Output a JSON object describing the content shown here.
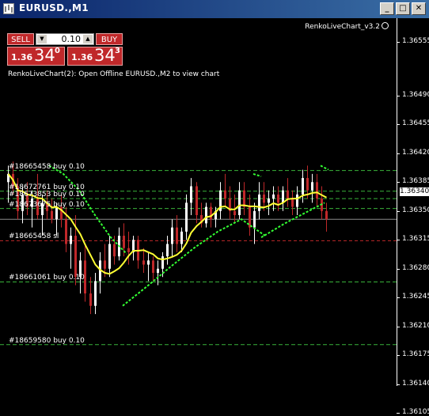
{
  "window": {
    "title": "EURUSD.,M1",
    "controls": {
      "minimize": "_",
      "maximize": "□",
      "close": "✕"
    }
  },
  "trade_panel": {
    "sell_label": "SELL",
    "buy_label": "BUY",
    "volume": "0.10",
    "sell_price_prefix": "1.36",
    "sell_price_big": "34",
    "sell_price_sup": "0",
    "buy_price_prefix": "1.36",
    "buy_price_big": "34",
    "buy_price_sup": "3"
  },
  "indicator_label": "RenkoLiveChart_v3.2",
  "chart_message": "RenkoLiveChart(2): Open Offline EURUSD.,M2 to view chart",
  "order_lines": [
    {
      "label": "#18665458 buy 0.10",
      "price": 1.36399
    },
    {
      "label": "#18672761 buy 0.10",
      "price": 1.36374
    },
    {
      "label": "#18673853 buy 0.10",
      "price": 1.36365
    },
    {
      "label": "#18673675 buy 0.10",
      "price": 1.36353
    },
    {
      "label": "#18665458 sl",
      "price": 1.36314
    },
    {
      "label": "#18661061 buy 0.10",
      "price": 1.36264
    },
    {
      "label": "#18659580 buy 0.10",
      "price": 1.36188
    }
  ],
  "price_axis": {
    "ticks": [
      "1.36555",
      "1.36490",
      "1.36455",
      "1.36420",
      "1.36385",
      "1.36350",
      "1.36315",
      "1.36280",
      "1.36245",
      "1.36210",
      "1.36175",
      "1.36140",
      "1.36105"
    ],
    "current_price": "1.36340"
  },
  "colors": {
    "background": "#000000",
    "bull_candle": "#ffffff",
    "bear_candle": "#c0282a",
    "order_line": "#39b33a",
    "stop_line": "#c0282a",
    "moving_average": "#ffff33",
    "trend_dots": "#33ff33"
  },
  "chart_data": {
    "type": "candlestick",
    "symbol": "EURUSD.",
    "timeframe": "M1",
    "ylim": [
      1.36105,
      1.36575
    ],
    "candles": [
      {
        "o": 1.36385,
        "h": 1.36405,
        "l": 1.3636,
        "c": 1.36395
      },
      {
        "o": 1.36395,
        "h": 1.3641,
        "l": 1.3637,
        "c": 1.3638
      },
      {
        "o": 1.3638,
        "h": 1.3639,
        "l": 1.3634,
        "c": 1.3635
      },
      {
        "o": 1.3635,
        "h": 1.3638,
        "l": 1.36335,
        "c": 1.3637
      },
      {
        "o": 1.3637,
        "h": 1.36385,
        "l": 1.36345,
        "c": 1.36355
      },
      {
        "o": 1.36355,
        "h": 1.36375,
        "l": 1.3633,
        "c": 1.36365
      },
      {
        "o": 1.36365,
        "h": 1.36395,
        "l": 1.3634,
        "c": 1.36345
      },
      {
        "o": 1.36345,
        "h": 1.3637,
        "l": 1.3632,
        "c": 1.3636
      },
      {
        "o": 1.3636,
        "h": 1.36375,
        "l": 1.3634,
        "c": 1.3635
      },
      {
        "o": 1.3635,
        "h": 1.36365,
        "l": 1.36335,
        "c": 1.3634
      },
      {
        "o": 1.3634,
        "h": 1.3636,
        "l": 1.3632,
        "c": 1.36355
      },
      {
        "o": 1.36355,
        "h": 1.3637,
        "l": 1.3633,
        "c": 1.3634
      },
      {
        "o": 1.3634,
        "h": 1.36355,
        "l": 1.363,
        "c": 1.3631
      },
      {
        "o": 1.3631,
        "h": 1.3633,
        "l": 1.3628,
        "c": 1.3632
      },
      {
        "o": 1.3632,
        "h": 1.36345,
        "l": 1.3626,
        "c": 1.3627
      },
      {
        "o": 1.3627,
        "h": 1.363,
        "l": 1.3625,
        "c": 1.3629
      },
      {
        "o": 1.3629,
        "h": 1.3631,
        "l": 1.3624,
        "c": 1.3625
      },
      {
        "o": 1.3625,
        "h": 1.3627,
        "l": 1.36225,
        "c": 1.36235
      },
      {
        "o": 1.36235,
        "h": 1.36275,
        "l": 1.36225,
        "c": 1.36265
      },
      {
        "o": 1.36265,
        "h": 1.363,
        "l": 1.3625,
        "c": 1.3629
      },
      {
        "o": 1.3629,
        "h": 1.3631,
        "l": 1.3627,
        "c": 1.3628
      },
      {
        "o": 1.3628,
        "h": 1.3632,
        "l": 1.3627,
        "c": 1.3631
      },
      {
        "o": 1.3631,
        "h": 1.3632,
        "l": 1.36285,
        "c": 1.36295
      },
      {
        "o": 1.36295,
        "h": 1.3633,
        "l": 1.3629,
        "c": 1.3632
      },
      {
        "o": 1.3632,
        "h": 1.36335,
        "l": 1.36295,
        "c": 1.36305
      },
      {
        "o": 1.36305,
        "h": 1.36325,
        "l": 1.36285,
        "c": 1.363
      },
      {
        "o": 1.363,
        "h": 1.3632,
        "l": 1.3629,
        "c": 1.36315
      },
      {
        "o": 1.36315,
        "h": 1.3632,
        "l": 1.3628,
        "c": 1.3629
      },
      {
        "o": 1.3629,
        "h": 1.36305,
        "l": 1.36275,
        "c": 1.36285
      },
      {
        "o": 1.36285,
        "h": 1.363,
        "l": 1.36265,
        "c": 1.3629
      },
      {
        "o": 1.3629,
        "h": 1.36295,
        "l": 1.36265,
        "c": 1.36275
      },
      {
        "o": 1.36275,
        "h": 1.3629,
        "l": 1.3626,
        "c": 1.3628
      },
      {
        "o": 1.3628,
        "h": 1.363,
        "l": 1.3627,
        "c": 1.36295
      },
      {
        "o": 1.36295,
        "h": 1.3632,
        "l": 1.36285,
        "c": 1.3631
      },
      {
        "o": 1.3631,
        "h": 1.3634,
        "l": 1.36295,
        "c": 1.3633
      },
      {
        "o": 1.3633,
        "h": 1.36345,
        "l": 1.363,
        "c": 1.3631
      },
      {
        "o": 1.3631,
        "h": 1.3633,
        "l": 1.363,
        "c": 1.36325
      },
      {
        "o": 1.36325,
        "h": 1.3637,
        "l": 1.36315,
        "c": 1.3636
      },
      {
        "o": 1.3636,
        "h": 1.3639,
        "l": 1.36345,
        "c": 1.3638
      },
      {
        "o": 1.3638,
        "h": 1.36385,
        "l": 1.36335,
        "c": 1.36345
      },
      {
        "o": 1.36345,
        "h": 1.3636,
        "l": 1.3633,
        "c": 1.36335
      },
      {
        "o": 1.36335,
        "h": 1.3636,
        "l": 1.3633,
        "c": 1.36355
      },
      {
        "o": 1.36355,
        "h": 1.3636,
        "l": 1.3633,
        "c": 1.3634
      },
      {
        "o": 1.3634,
        "h": 1.36355,
        "l": 1.3633,
        "c": 1.3635
      },
      {
        "o": 1.3635,
        "h": 1.36385,
        "l": 1.3634,
        "c": 1.36375
      },
      {
        "o": 1.36375,
        "h": 1.36395,
        "l": 1.36355,
        "c": 1.36365
      },
      {
        "o": 1.36365,
        "h": 1.3638,
        "l": 1.3634,
        "c": 1.3635
      },
      {
        "o": 1.3635,
        "h": 1.3637,
        "l": 1.36335,
        "c": 1.36345
      },
      {
        "o": 1.36345,
        "h": 1.36385,
        "l": 1.3634,
        "c": 1.36375
      },
      {
        "o": 1.36375,
        "h": 1.36385,
        "l": 1.36345,
        "c": 1.36355
      },
      {
        "o": 1.36355,
        "h": 1.3637,
        "l": 1.3632,
        "c": 1.3633
      },
      {
        "o": 1.3633,
        "h": 1.3636,
        "l": 1.3631,
        "c": 1.3635
      },
      {
        "o": 1.3635,
        "h": 1.36385,
        "l": 1.3634,
        "c": 1.3637
      },
      {
        "o": 1.3637,
        "h": 1.36385,
        "l": 1.3635,
        "c": 1.3636
      },
      {
        "o": 1.3636,
        "h": 1.36375,
        "l": 1.36345,
        "c": 1.36365
      },
      {
        "o": 1.36365,
        "h": 1.3638,
        "l": 1.3635,
        "c": 1.3637
      },
      {
        "o": 1.3637,
        "h": 1.3638,
        "l": 1.3635,
        "c": 1.3636
      },
      {
        "o": 1.3636,
        "h": 1.3638,
        "l": 1.3635,
        "c": 1.36375
      },
      {
        "o": 1.36375,
        "h": 1.3639,
        "l": 1.36355,
        "c": 1.36365
      },
      {
        "o": 1.36365,
        "h": 1.36375,
        "l": 1.36345,
        "c": 1.36355
      },
      {
        "o": 1.36355,
        "h": 1.3638,
        "l": 1.36345,
        "c": 1.3637
      },
      {
        "o": 1.3637,
        "h": 1.364,
        "l": 1.3636,
        "c": 1.3639
      },
      {
        "o": 1.3639,
        "h": 1.36405,
        "l": 1.36365,
        "c": 1.36375
      },
      {
        "o": 1.36375,
        "h": 1.36395,
        "l": 1.3636,
        "c": 1.36385
      },
      {
        "o": 1.36385,
        "h": 1.36395,
        "l": 1.36355,
        "c": 1.36365
      },
      {
        "o": 1.36365,
        "h": 1.3638,
        "l": 1.3634,
        "c": 1.3635
      },
      {
        "o": 1.3635,
        "h": 1.3636,
        "l": 1.36325,
        "c": 1.3634
      }
    ]
  }
}
